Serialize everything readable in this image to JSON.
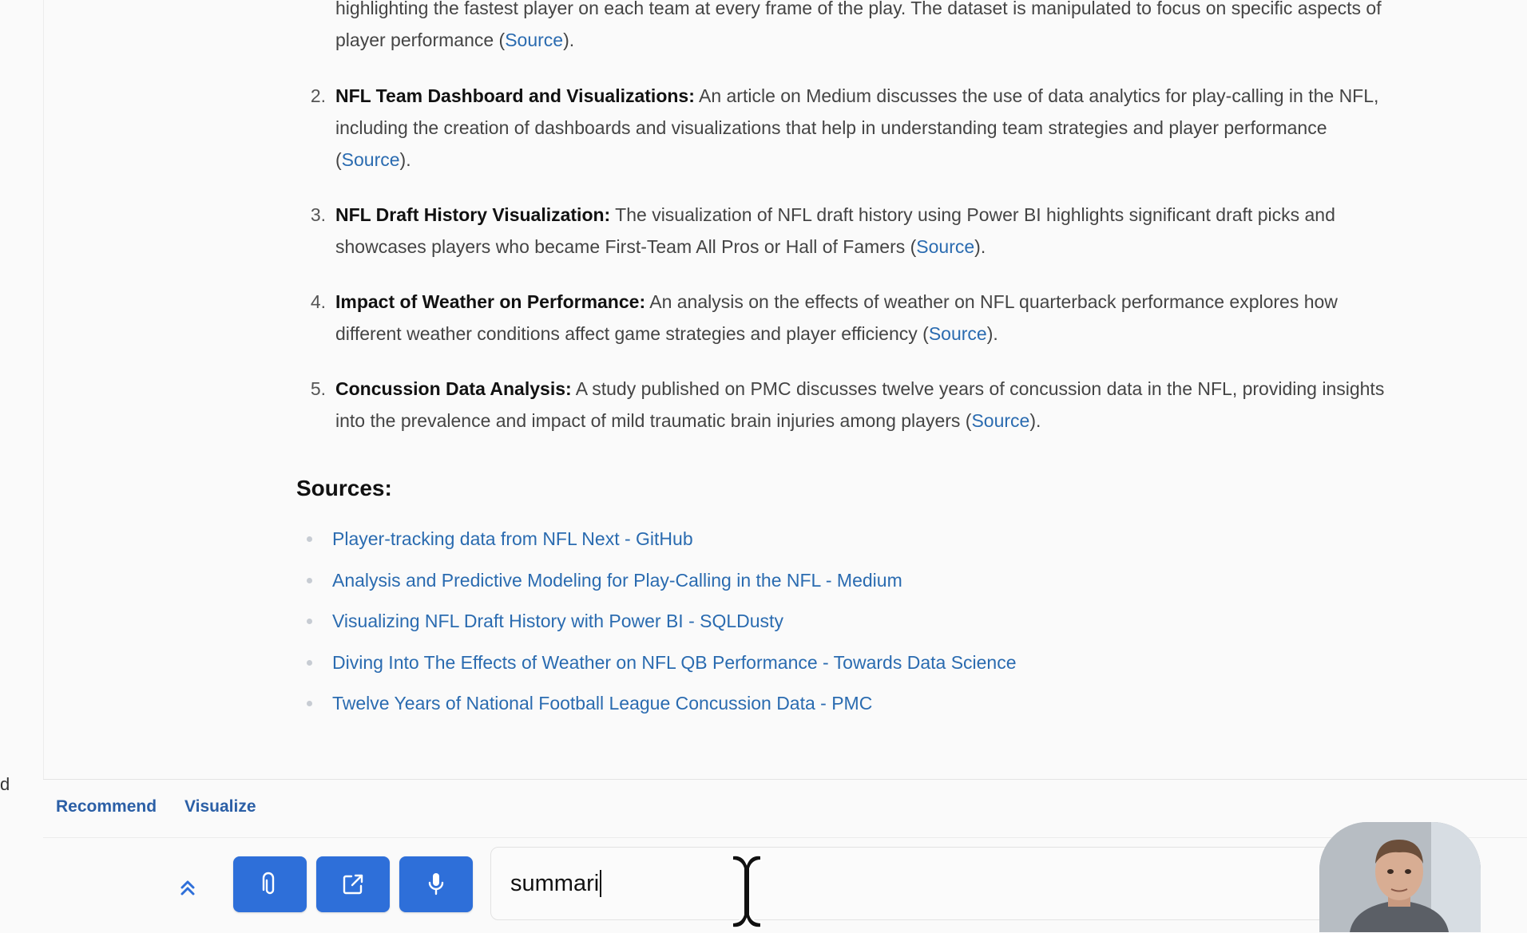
{
  "rail": {
    "partial_text": "d"
  },
  "answer": {
    "items": [
      {
        "number": "",
        "lead": "",
        "text": "highlighting the fastest player on each team at every frame of the play. The dataset is manipulated to focus on specific aspects of player performance (",
        "link": "Source",
        "after": ")."
      },
      {
        "number": "2.",
        "lead": "NFL Team Dashboard and Visualizations:",
        "text": " An article on Medium discusses the use of data analytics for play-calling in the NFL, including the creation of dashboards and visualizations that help in understanding team strategies and player performance (",
        "link": "Source",
        "after": ")."
      },
      {
        "number": "3.",
        "lead": "NFL Draft History Visualization:",
        "text": " The visualization of NFL draft history using Power BI highlights significant draft picks and showcases players who became First-Team All Pros or Hall of Famers (",
        "link": "Source",
        "after": ")."
      },
      {
        "number": "4.",
        "lead": "Impact of Weather on Performance:",
        "text": " An analysis on the effects of weather on NFL quarterback performance explores how different weather conditions affect game strategies and player efficiency (",
        "link": "Source",
        "after": ")."
      },
      {
        "number": "5.",
        "lead": "Concussion Data Analysis:",
        "text": " A study published on PMC discusses twelve years of concussion data in the NFL, providing insights into the prevalence and impact of mild traumatic brain injuries among players (",
        "link": "Source",
        "after": ")."
      }
    ],
    "sources_heading": "Sources:",
    "sources": [
      "Player-tracking data from NFL Next - GitHub",
      "Analysis and Predictive Modeling for Play-Calling in the NFL - Medium",
      "Visualizing NFL Draft History with Power BI - SQLDusty",
      "Diving Into The Effects of Weather on NFL QB Performance - Towards Data Science",
      "Twelve Years of National Football League Concussion Data - PMC"
    ]
  },
  "bottom_bar": {
    "tabs": [
      "Recommend",
      "Visualize"
    ],
    "input_value": "summari",
    "buttons": [
      {
        "icon": "paperclip-icon"
      },
      {
        "icon": "external-link-icon"
      },
      {
        "icon": "microphone-icon"
      }
    ],
    "expand_icon": "double-chevron-up-icon"
  },
  "colors": {
    "accent": "#2e6fd9",
    "link": "#2a6bb0",
    "tab_text": "#2b5fa6",
    "background": "#fafafa"
  }
}
